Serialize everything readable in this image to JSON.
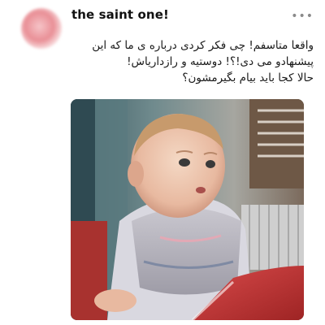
{
  "tweet": {
    "author_name": "the saint one!",
    "lines": [
      "واقعا متاسفم! چی فکر کردی درباره ی ما که این",
      "پیشنهادو می دی!؟! دوستیه و رازداریاش!",
      "حالا کجا باید بیام بگیرمشون؟"
    ],
    "more_icon": "ellipsis-icon",
    "media_description_icon": "photo"
  }
}
